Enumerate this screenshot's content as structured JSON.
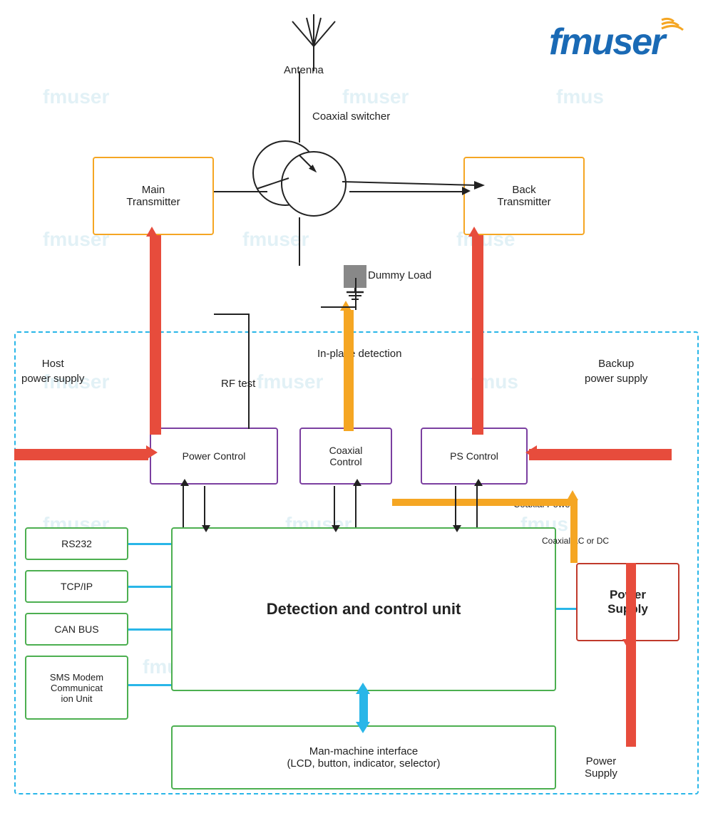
{
  "logo": {
    "text": "fmuser",
    "signal_color": "#f5a623"
  },
  "labels": {
    "antenna": "Antenna",
    "coaxial_switcher": "Coaxial switcher",
    "main_transmitter": "Main\nTransmitter",
    "back_transmitter": "Back\nTransmitter",
    "dummy_load": "Dummy Load",
    "host_power_supply": "Host\npower supply",
    "backup_power_supply": "Backup\npower supply",
    "rf_test": "RF test",
    "in_place_detection": "In-place detection",
    "power_control": "Power Control",
    "coaxial_control": "Coaxial\nControl",
    "ps_control": "PS Control",
    "coaxial_power": "Coaxial Power",
    "coaxial_ac_dc": "Coaxial AC or DC",
    "power_supply_box": "Power\nSupply",
    "power_supply_label": "Power\nSupply",
    "rs232": "RS232",
    "tcp_ip": "TCP/IP",
    "can_bus": "CAN BUS",
    "sms_modem": "SMS Modem\nCommunicat\nion Unit",
    "detection_control": "Detection and control unit",
    "man_machine": "Man-machine interface\n(LCD, button, indicator, selector)"
  },
  "watermarks": [
    "fmuser",
    "fmus",
    "fmuse",
    "fmus"
  ]
}
